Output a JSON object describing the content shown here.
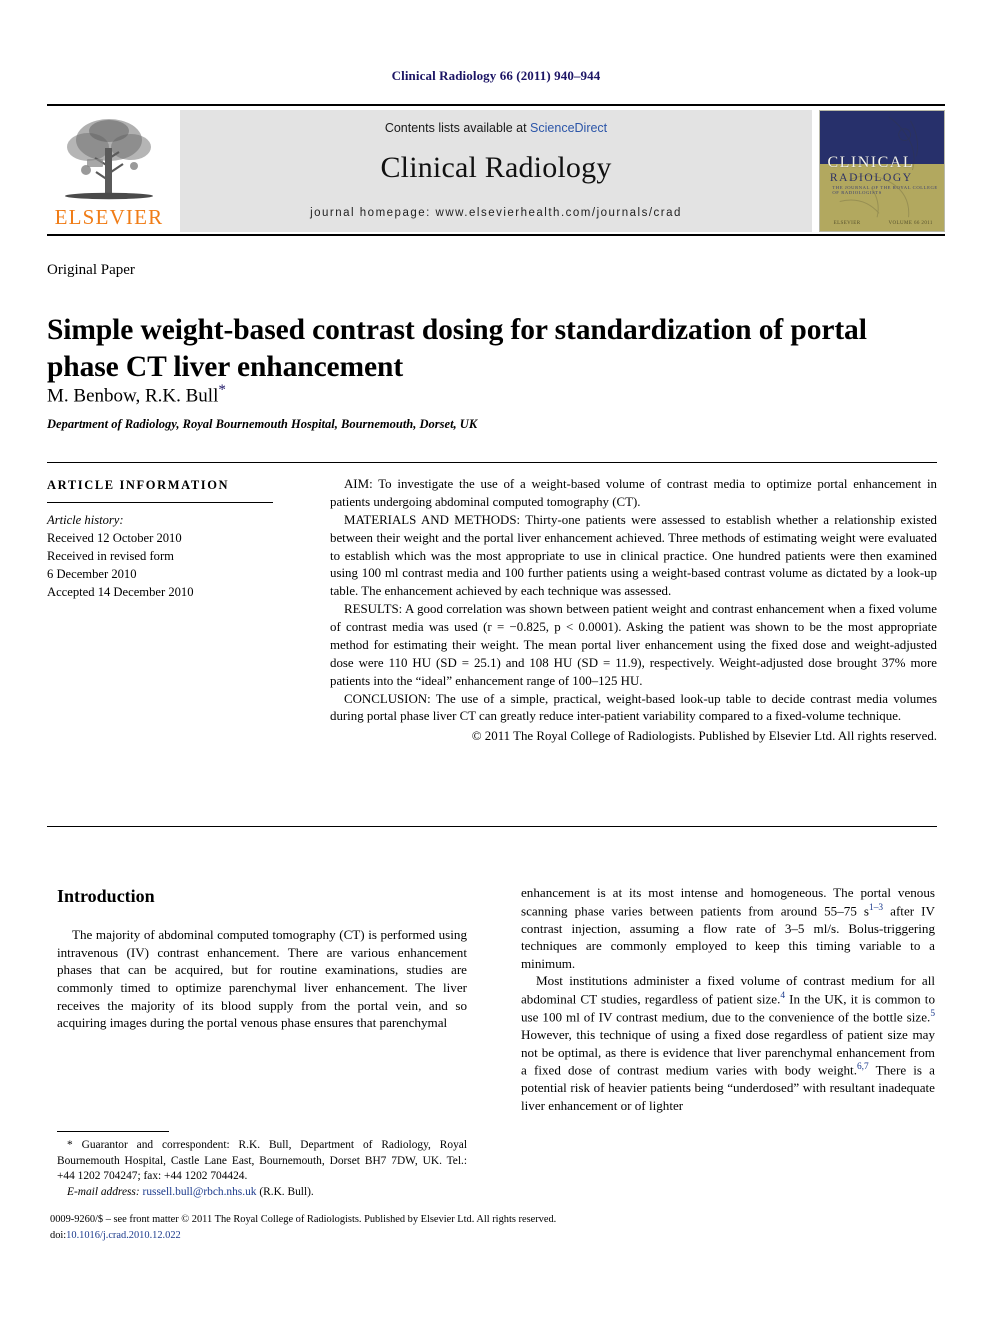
{
  "running_head": "Clinical Radiology 66 (2011) 940–944",
  "masthead": {
    "publisher_logo_label": "ELSEVIER",
    "contents_prefix": "Contents lists available at ",
    "contents_link": "ScienceDirect",
    "journal_title": "Clinical Radiology",
    "homepage": "journal homepage: www.elsevierhealth.com/journals/crad",
    "cover": {
      "line1": "CLINICAL",
      "line2": "RADIOLOGY",
      "line3": "THE JOURNAL OF THE ROYAL COLLEGE OF RADIOLOGISTS",
      "line4": "ELSEVIER",
      "line5": "VOLUME 66 2011"
    }
  },
  "article": {
    "kind": "Original Paper",
    "title": "Simple weight-based contrast dosing for standardization of portal phase CT liver enhancement",
    "authors": "M. Benbow, R.K. Bull",
    "corresponding_marker": "*",
    "affiliation": "Department of Radiology, Royal Bournemouth Hospital, Bournemouth, Dorset, UK"
  },
  "article_information": {
    "heading": "ARTICLE INFORMATION",
    "history_label": "Article history:",
    "received": "Received 12 October 2010",
    "revised_label": "Received in revised form",
    "revised_date": "6 December 2010",
    "accepted": "Accepted 14 December 2010"
  },
  "abstract": {
    "aim_label": "AIM:",
    "aim_text": " To investigate the use of a weight-based volume of contrast media to optimize portal enhancement in patients undergoing abdominal computed tomography (CT).",
    "methods_label": "MATERIALS AND METHODS:",
    "methods_text": " Thirty-one patients were assessed to establish whether a relationship existed between their weight and the portal liver enhancement achieved. Three methods of estimating weight were evaluated to establish which was the most appropriate to use in clinical practice. One hundred patients were then examined using 100 ml contrast media and 100 further patients using a weight-based contrast volume as dictated by a look-up table. The enhancement achieved by each technique was assessed.",
    "results_label": "RESULTS:",
    "results_text": " A good correlation was shown between patient weight and contrast enhancement when a fixed volume of contrast media was used (r = −0.825, p < 0.0001). Asking the patient was shown to be the most appropriate method for estimating their weight. The mean portal liver enhancement using the fixed dose and weight-adjusted dose were 110 HU (SD = 25.1) and 108 HU (SD = 11.9), respectively. Weight-adjusted dose brought 37% more patients into the “ideal” enhancement range of 100–125 HU.",
    "conclusion_label": "CONCLUSION:",
    "conclusion_text": " The use of a simple, practical, weight-based look-up table to decide contrast media volumes during portal phase liver CT can greatly reduce inter-patient variability compared to a fixed-volume technique.",
    "copyright": "© 2011 The Royal College of Radiologists. Published by Elsevier Ltd. All rights reserved."
  },
  "introduction": {
    "heading": "Introduction",
    "left_p1_a": "The majority of abdominal computed tomography (CT) is performed using intravenous (IV) contrast enhancement. There are various enhancement phases that can be acquired, but for routine examinations, studies are commonly timed to optimize parenchymal liver enhancement. The liver receives the majority of its blood supply from the portal vein, and so acquiring images during the portal venous phase ensures that parenchymal",
    "right_p1_cont_a": "enhancement is at its most intense and homogeneous. The portal venous scanning phase varies between patients from around 55–75 s",
    "right_p1_ref1": "1–3",
    "right_p1_cont_b": " after IV contrast injection, assuming a flow rate of 3–5 ml/s. Bolus-triggering techniques are commonly employed to keep this timing variable to a minimum.",
    "right_p2_a": "Most institutions administer a fixed volume of contrast medium for all abdominal CT studies, regardless of patient size.",
    "right_p2_ref1": "4",
    "right_p2_b": " In the UK, it is common to use 100 ml of IV contrast medium, due to the convenience of the bottle size.",
    "right_p2_ref2": "5",
    "right_p2_c": " However, this technique of using a fixed dose regardless of patient size may not be optimal, as there is evidence that liver parenchymal enhancement from a fixed dose of contrast medium varies with body weight.",
    "right_p2_ref3": "6,7",
    "right_p2_d": " There is a potential risk of heavier patients being “underdosed” with resultant inadequate liver enhancement or of lighter"
  },
  "footnote": {
    "marker": "*",
    "corresponding_text": " Guarantor and correspondent: R.K. Bull, Department of Radiology, Royal Bournemouth Hospital, Castle Lane East, Bournemouth, Dorset BH7 7DW, UK. Tel.: +44 1202 704247; fax: +44 1202 704424.",
    "email_label": "E-mail address:",
    "email_address": "russell.bull@rbch.nhs.uk",
    "email_owner": " (R.K. Bull)."
  },
  "imprint": {
    "issn_line": "0009-9260/$ – see front matter © 2011 The Royal College of Radiologists. Published by Elsevier Ltd. All rights reserved.",
    "doi_prefix": "doi:",
    "doi_value": "10.1016/j.crad.2010.12.022"
  },
  "colors": {
    "accent_blue": "#1b1464",
    "link_blue": "#2b55a8",
    "elsevier_orange": "#f07c16",
    "band_gray": "#e3e3e3",
    "cover_navy": "#27306b",
    "cover_olive": "#b2a85f"
  }
}
